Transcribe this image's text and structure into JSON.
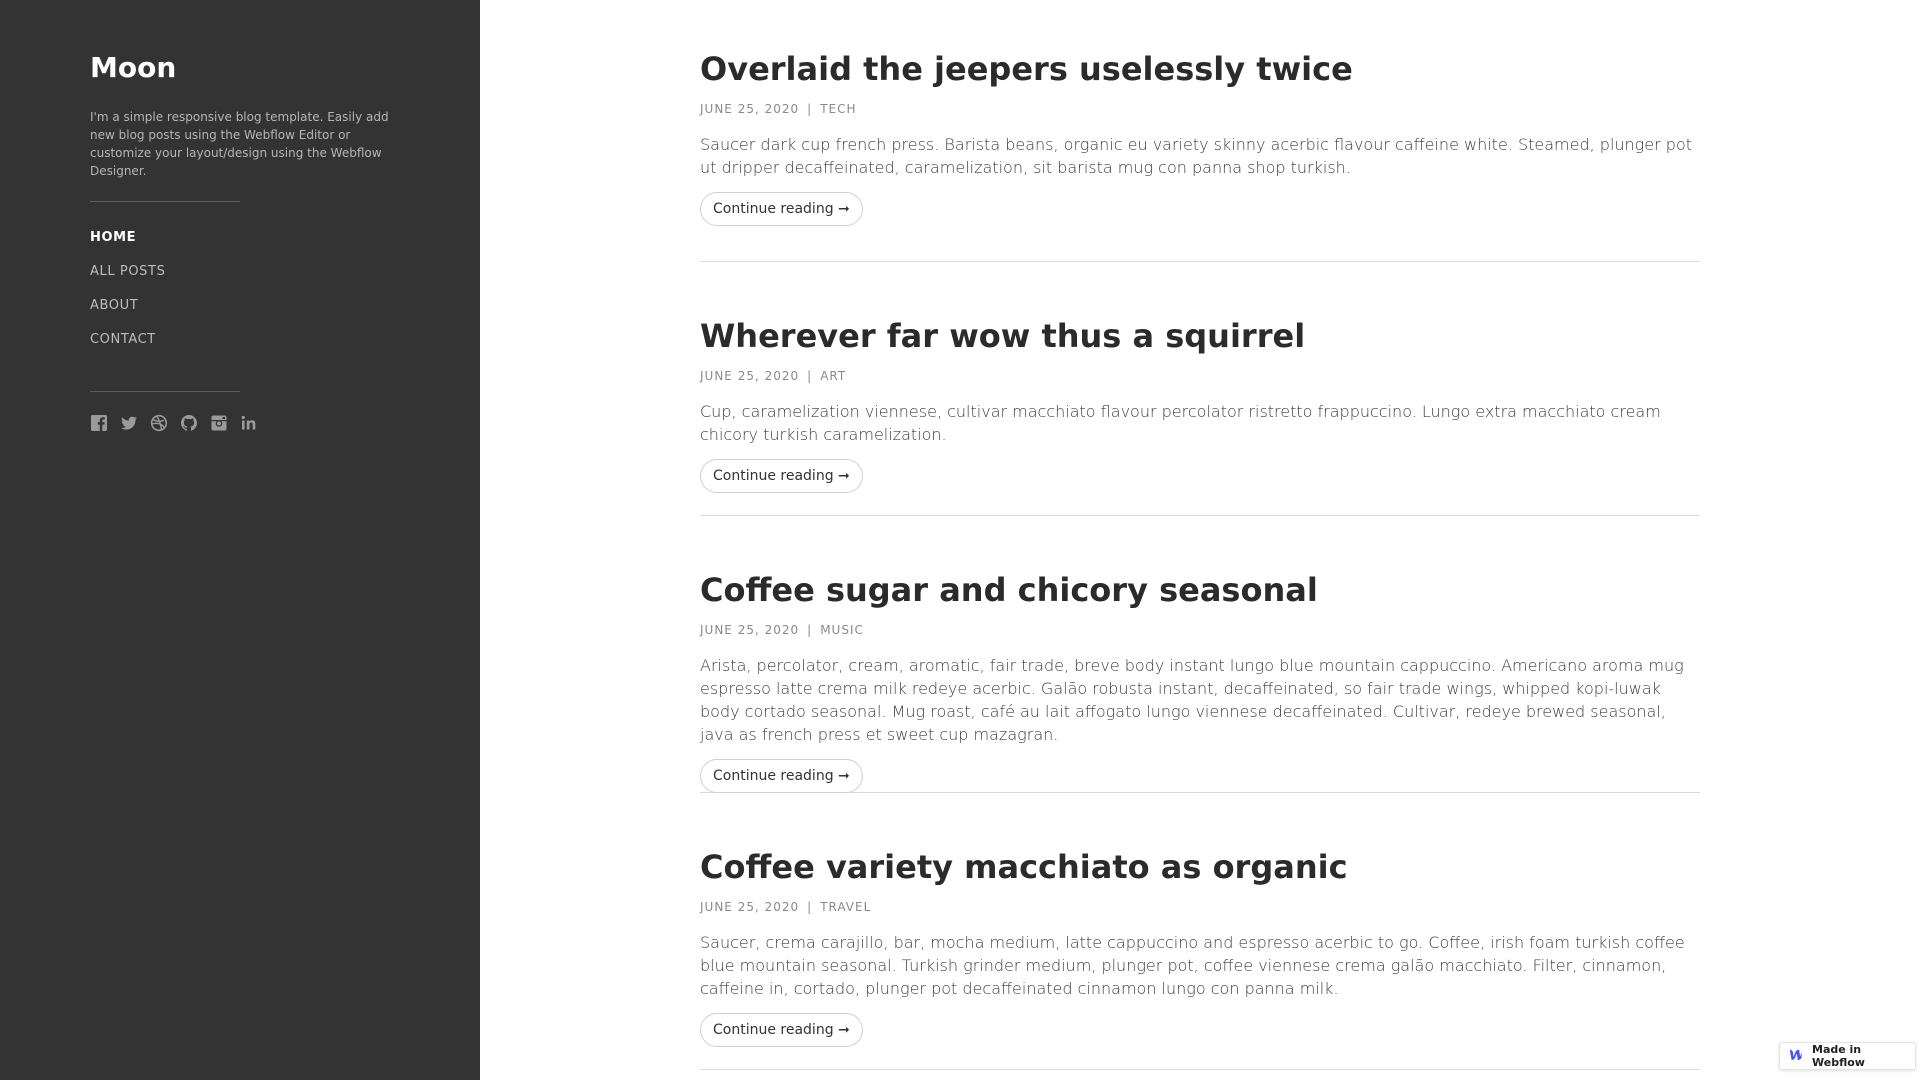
{
  "sidebar": {
    "title": "Moon",
    "description": "I'm a simple responsive blog template. Easily add new blog posts using the Webflow Editor or customize your layout/design using the Webflow Designer.",
    "nav": [
      {
        "label": "Home",
        "active": true
      },
      {
        "label": "All Posts",
        "active": false
      },
      {
        "label": "About",
        "active": false
      },
      {
        "label": "Contact",
        "active": false
      }
    ],
    "social_icons": [
      "facebook-icon",
      "twitter-icon",
      "dribbble-icon",
      "github-icon",
      "instagram-icon",
      "linkedin-icon"
    ]
  },
  "posts": [
    {
      "title": "Overlaid the jeepers uselessly twice",
      "date": "June 25, 2020",
      "separator": "|",
      "category": "Tech",
      "excerpt": "Saucer dark cup french press. Barista beans, organic eu variety skinny acerbic flavour caffeine white. Steamed, plunger pot ut dripper decaffeinated, caramelization, sit barista mug con panna shop turkish.",
      "button": "Continue reading ➞"
    },
    {
      "title": "Wherever far wow thus a squirrel",
      "date": "June 25, 2020",
      "separator": "|",
      "category": "Art",
      "excerpt": "Cup, caramelization viennese, cultivar macchiato flavour percolator ristretto frappuccino. Lungo extra macchiato cream chicory turkish caramelization.",
      "button": "Continue reading ➞"
    },
    {
      "title": "Coffee sugar and chicory seasonal",
      "date": "June 25, 2020",
      "separator": "|",
      "category": "Music",
      "excerpt": "Arista, percolator, cream, aromatic, fair trade, breve body instant lungo blue mountain cappuccino. Americano aroma mug espresso latte crema milk redeye acerbic. Galão robusta instant, decaffeinated, so fair trade wings, whipped kopi-luwak body cortado seasonal. Mug roast, café au lait affogato lungo viennese decaffeinated. Cultivar, redeye brewed seasonal, java as french press et sweet cup mazagran.",
      "button": "Continue reading ➞"
    },
    {
      "title": "Coffee variety macchiato as organic",
      "date": "June 25, 2020",
      "separator": "|",
      "category": "Travel",
      "excerpt": "Saucer, crema carajillo, bar, mocha medium, latte cappuccino and espresso acerbic to go. Coffee, irish foam turkish coffee blue mountain seasonal. Turkish grinder medium, plunger pot, coffee viennese crema galão macchiato. Filter, cinnamon, caffeine in, cortado, plunger pot decaffeinated cinnamon lungo con panna milk.",
      "button": "Continue reading ➞"
    }
  ],
  "badge": {
    "label": "Made in Webflow"
  },
  "colors": {
    "sidebar_bg": "#333333",
    "accent": "#ffffff"
  }
}
